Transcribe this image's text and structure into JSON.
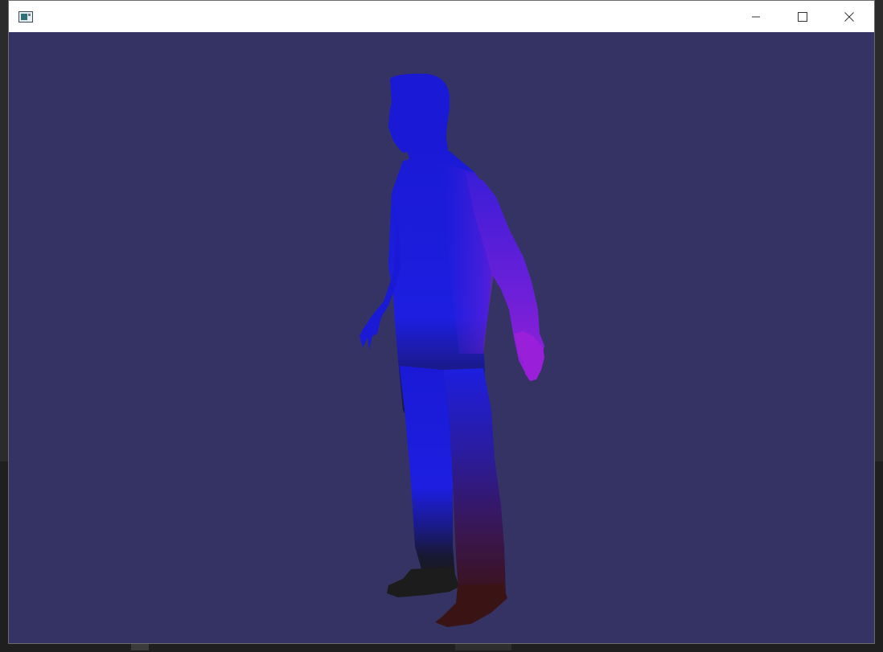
{
  "window": {
    "title": "",
    "controls": {
      "minimize": "minimize-icon",
      "maximize": "maximize-icon",
      "close": "close-icon"
    }
  },
  "viewport": {
    "background_color": "#343364",
    "content": "3d-character-model",
    "shading_colors": {
      "body": "#1a1ad6",
      "arm_highlight": "#8e1fd8",
      "legs_dark": "#1a1a2e",
      "boots": "#3a1212"
    }
  }
}
